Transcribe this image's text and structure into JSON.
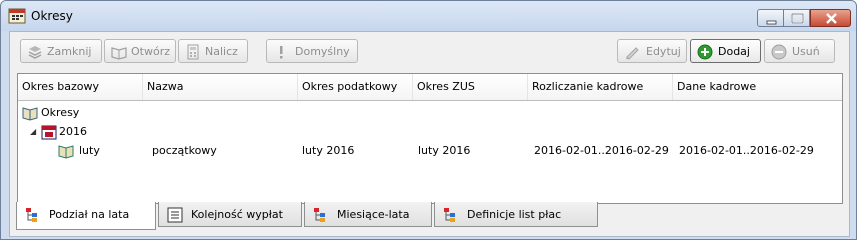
{
  "window": {
    "title": "Okresy"
  },
  "window_icons": {
    "app": "book-calendar-icon",
    "minimize": "minimize-icon",
    "maximize": "maximize-icon",
    "close": "close-icon"
  },
  "toolbar": {
    "close_label": "Zamknij",
    "open_label": "Otwórz",
    "calculate_label": "Nalicz",
    "default_label": "Domyślny",
    "edit_label": "Edytuj",
    "add_label": "Dodaj",
    "delete_label": "Usuń"
  },
  "grid": {
    "columns": [
      "Okres bazowy",
      "Nazwa",
      "Okres podatkowy",
      "Okres ZUS",
      "Rozliczanie kadrowe",
      "Dane kadrowe"
    ],
    "tree": {
      "root_label": "Okresy",
      "year_label": "2016",
      "expand_glyph": "◢"
    },
    "rows": [
      {
        "period": "luty",
        "name": "początkowy",
        "tax_period": "luty 2016",
        "zus_period": "luty 2016",
        "hr_settlement": "2016-02-01..2016-02-29",
        "hr_data": "2016-02-01..2016-02-29"
      }
    ]
  },
  "tabs": [
    {
      "label": "Podział na lata",
      "active": true,
      "icon": "tree-icon"
    },
    {
      "label": "Kolejność wypłat",
      "active": false,
      "icon": "list-icon"
    },
    {
      "label": "Miesiące-lata",
      "active": false,
      "icon": "tree-icon"
    },
    {
      "label": "Definicje list płac",
      "active": false,
      "icon": "tree-icon"
    }
  ],
  "colors": {
    "accent_green": "#2e9b2e",
    "disabled_text": "#8d8d8d",
    "close_button": "#c84b32"
  }
}
